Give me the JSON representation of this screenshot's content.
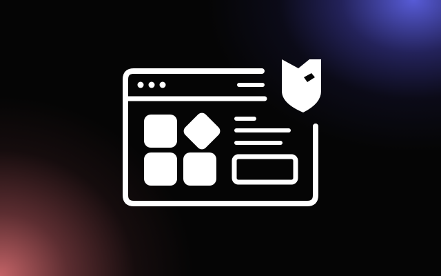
{
  "scene": {
    "background_color": "#050505",
    "glow_top_right_color": "#5c60e2",
    "glow_bottom_left_color": "#cd686c",
    "icon_color": "#ffffff"
  },
  "icons": {
    "main": "app-window-dashboard-icon",
    "badge": "shield-badge-icon"
  }
}
